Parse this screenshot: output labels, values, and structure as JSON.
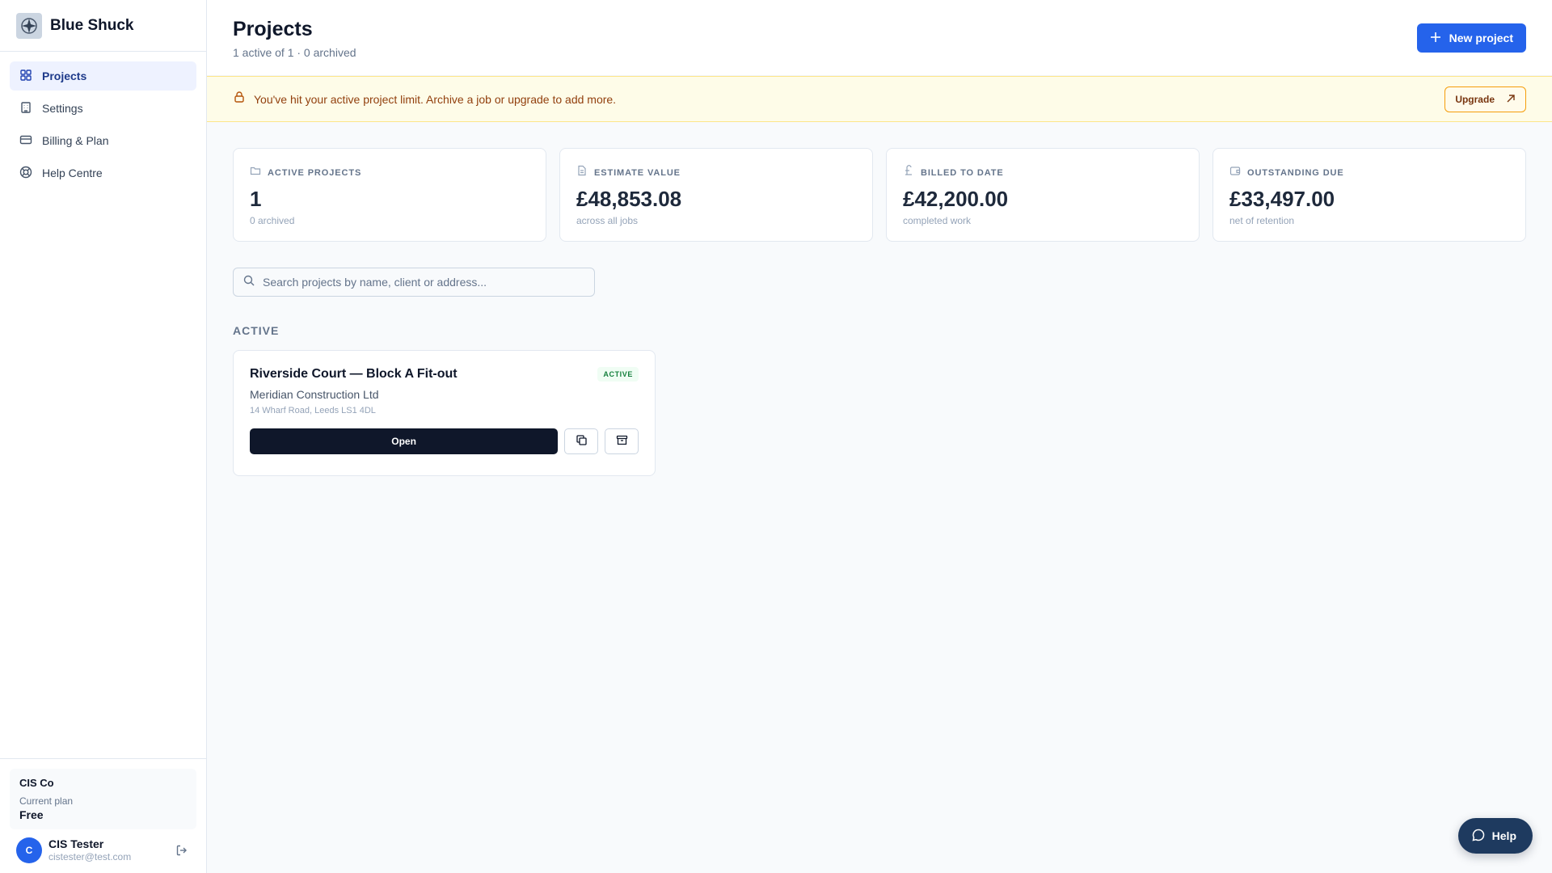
{
  "app": {
    "name": "Blue Shuck"
  },
  "sidebar": {
    "items": [
      {
        "label": "Projects",
        "icon": "grid-icon",
        "active": true
      },
      {
        "label": "Settings",
        "icon": "building-icon",
        "active": false
      },
      {
        "label": "Billing & Plan",
        "icon": "credit-card-icon",
        "active": false
      },
      {
        "label": "Help Centre",
        "icon": "lifebuoy-icon",
        "active": false
      }
    ],
    "plan": {
      "org": "CIS Co",
      "label": "Current plan",
      "name": "Free"
    },
    "user": {
      "initial": "C",
      "name": "CIS Tester",
      "email": "cistester@test.com"
    }
  },
  "header": {
    "title": "Projects",
    "subtitle": "1 active of 1 · 0 archived",
    "new_button": "New project"
  },
  "banner": {
    "text": "You've hit your active project limit. Archive a job or upgrade to add more.",
    "upgrade_button": "Upgrade"
  },
  "stats": [
    {
      "label": "ACTIVE PROJECTS",
      "value": "1",
      "sub": "0 archived",
      "icon": "folder-icon"
    },
    {
      "label": "ESTIMATE VALUE",
      "value": "£48,853.08",
      "sub": "across all jobs",
      "icon": "document-icon"
    },
    {
      "label": "BILLED TO DATE",
      "value": "£42,200.00",
      "sub": "completed work",
      "icon": "pound-icon"
    },
    {
      "label": "OUTSTANDING DUE",
      "value": "£33,497.00",
      "sub": "net of retention",
      "icon": "wallet-icon"
    }
  ],
  "search": {
    "placeholder": "Search projects by name, client or address..."
  },
  "section": {
    "title": "ACTIVE"
  },
  "projects": [
    {
      "name": "Riverside Court — Block A Fit-out",
      "client": "Meridian Construction Ltd",
      "address": "14 Wharf Road, Leeds LS1 4DL",
      "status": "ACTIVE",
      "open_button": "Open"
    }
  ],
  "help": {
    "label": "Help"
  },
  "colors": {
    "primary": "#2563eb",
    "dark": "#0f172a",
    "banner_bg": "#fefce8",
    "success": "#15803d"
  }
}
